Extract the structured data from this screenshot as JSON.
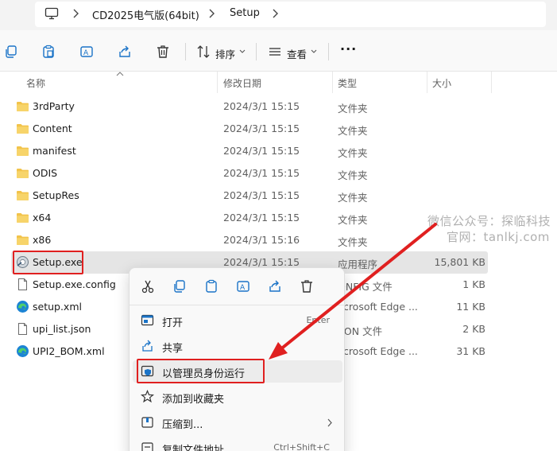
{
  "breadcrumb": {
    "items": [
      "CD2025电气版(64bit)",
      "Setup"
    ]
  },
  "toolbar": {
    "sort_label": "排序",
    "view_label": "查看",
    "more_label": "···"
  },
  "columns": {
    "name": "名称",
    "date": "修改日期",
    "type": "类型",
    "size": "大小"
  },
  "files": [
    {
      "name": "3rdParty",
      "date": "2024/3/1 15:15",
      "type": "文件夹",
      "size": "",
      "icon": "folder-icon"
    },
    {
      "name": "Content",
      "date": "2024/3/1 15:15",
      "type": "文件夹",
      "size": "",
      "icon": "folder-icon"
    },
    {
      "name": "manifest",
      "date": "2024/3/1 15:15",
      "type": "文件夹",
      "size": "",
      "icon": "folder-icon"
    },
    {
      "name": "ODIS",
      "date": "2024/3/1 15:15",
      "type": "文件夹",
      "size": "",
      "icon": "folder-icon"
    },
    {
      "name": "SetupRes",
      "date": "2024/3/1 15:15",
      "type": "文件夹",
      "size": "",
      "icon": "folder-icon"
    },
    {
      "name": "x64",
      "date": "2024/3/1 15:15",
      "type": "文件夹",
      "size": "",
      "icon": "folder-icon"
    },
    {
      "name": "x86",
      "date": "2024/3/1 15:16",
      "type": "文件夹",
      "size": "",
      "icon": "folder-icon"
    },
    {
      "name": "Setup.exe",
      "date": "2024/3/1 15:15",
      "type": "应用程序",
      "size": "15,801 KB",
      "icon": "installer-icon"
    },
    {
      "name": "Setup.exe.config",
      "date": "",
      "type": "ONFIG 文件",
      "size": "1 KB",
      "icon": "file-icon"
    },
    {
      "name": "setup.xml",
      "date": "",
      "type": "licrosoft Edge ...",
      "size": "11 KB",
      "icon": "edge-icon"
    },
    {
      "name": "upi_list.json",
      "date": "",
      "type": "SON 文件",
      "size": "2 KB",
      "icon": "file-icon"
    },
    {
      "name": "UPI2_BOM.xml",
      "date": "",
      "type": "licrosoft Edge ...",
      "size": "31 KB",
      "icon": "edge-icon"
    }
  ],
  "context_menu": {
    "items": [
      {
        "label": "打开",
        "shortcut": "Enter",
        "icon": "open-icon"
      },
      {
        "label": "共享",
        "shortcut": "",
        "icon": "share-icon"
      },
      {
        "label": "以管理员身份运行",
        "shortcut": "",
        "icon": "shield-icon"
      },
      {
        "label": "添加到收藏夹",
        "shortcut": "",
        "icon": "star-icon"
      },
      {
        "label": "压缩到...",
        "shortcut": "",
        "icon": "zip-icon"
      },
      {
        "label": "复制文件地址",
        "shortcut": "Ctrl+Shift+C",
        "icon": "copy-path-icon"
      }
    ]
  },
  "watermark": {
    "line1": "微信公众号：探临科技",
    "line2": "官网：tanlkj.com"
  },
  "colors": {
    "folder": "#f2c34a",
    "accent": "#0067c0",
    "highlight": "#e02020"
  }
}
